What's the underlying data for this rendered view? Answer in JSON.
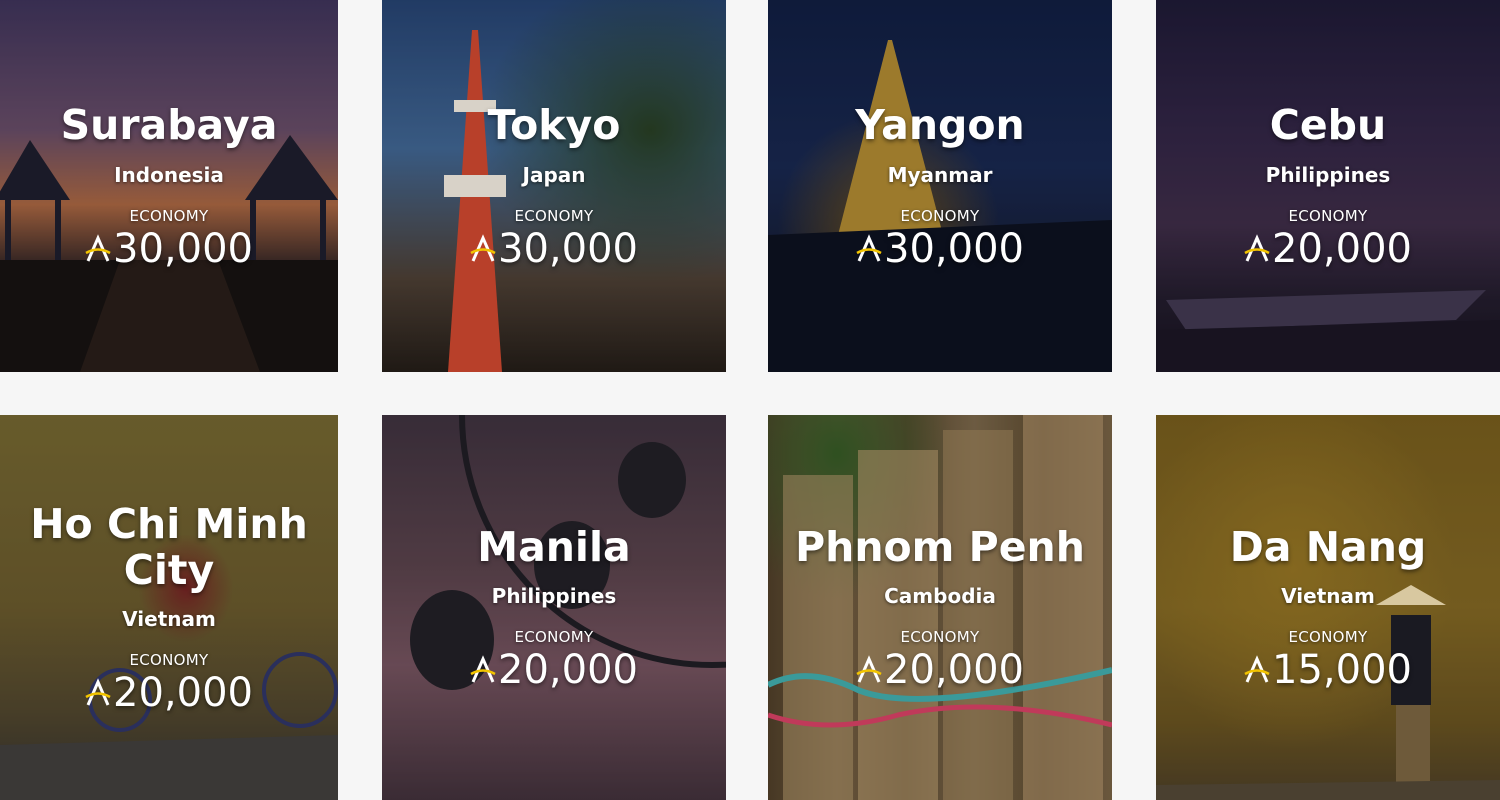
{
  "colors": {
    "page_background": "#f6f6f6",
    "text": "#ffffff",
    "currency_accent": "#f2c400"
  },
  "icons": {
    "currency": "asiana-mileage-icon"
  },
  "destinations": [
    {
      "city": "Surabaya",
      "country": "Indonesia",
      "cabin": "ECONOMY",
      "price": "30,000"
    },
    {
      "city": "Tokyo",
      "country": "Japan",
      "cabin": "ECONOMY",
      "price": "30,000"
    },
    {
      "city": "Yangon",
      "country": "Myanmar",
      "cabin": "ECONOMY",
      "price": "30,000"
    },
    {
      "city": "Cebu",
      "country": "Philippines",
      "cabin": "ECONOMY",
      "price": "20,000"
    },
    {
      "city": "Ho Chi Minh City",
      "country": "Vietnam",
      "cabin": "ECONOMY",
      "price": "20,000"
    },
    {
      "city": "Manila",
      "country": "Philippines",
      "cabin": "ECONOMY",
      "price": "20,000"
    },
    {
      "city": "Phnom Penh",
      "country": "Cambodia",
      "cabin": "ECONOMY",
      "price": "20,000"
    },
    {
      "city": "Da Nang",
      "country": "Vietnam",
      "cabin": "ECONOMY",
      "price": "15,000"
    }
  ]
}
